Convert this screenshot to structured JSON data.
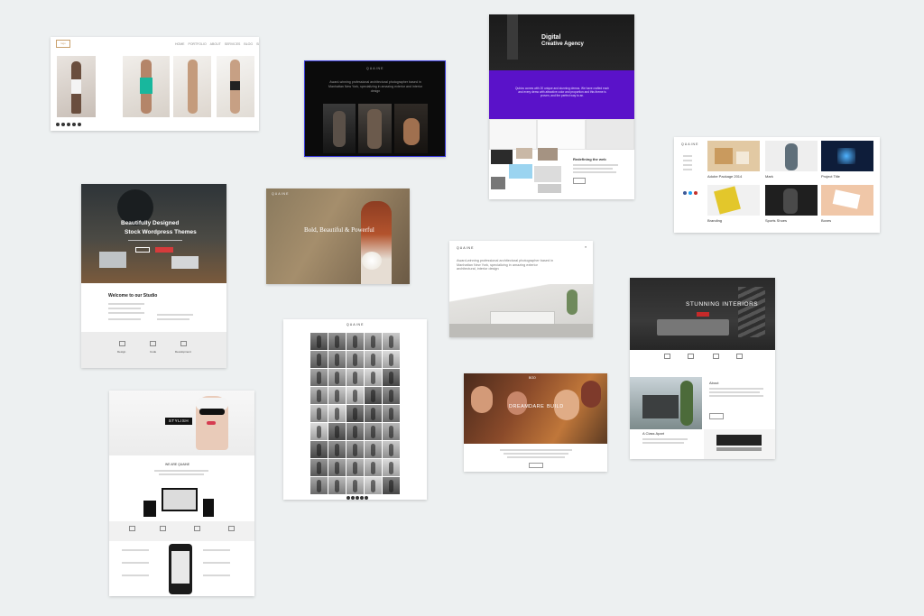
{
  "colors": {
    "background": "#edf0f1",
    "purple": "#5a12c9",
    "dark": "#111111",
    "red": "#c62a2a"
  },
  "card1": {
    "logo": "logo",
    "nav": [
      "HOME",
      "PORTFOLIO",
      "ABOUT",
      "SERVICES",
      "BLOG",
      "SHOP",
      "CONTACT"
    ]
  },
  "card2": {
    "brand": "QUAINE",
    "text": "Award-winning professional architectural photographer based in Manhattan New York, specializing in amazing exterior and interior design"
  },
  "card3": {
    "title1": "Digital",
    "title2": "Creative Agency",
    "purple_text": "Qubics comes with 20 unique and stunning demos. We have crafted each and every demo with attractive color and proportion and this theme is proven, and the perfect way to an.",
    "sub": "Redefining the web"
  },
  "card4": {
    "brand": "QUAINE",
    "items": [
      "Adobe Package 2014",
      "Mark",
      "Project Title",
      "Branding",
      "Sports Shoes",
      "Boxes"
    ]
  },
  "card5": {
    "hero1": "Beautifully Designed",
    "hero2": "Stock Wordpress Themes",
    "welcome": "Welcome to our Studio",
    "features": [
      "Design",
      "Code",
      "Development"
    ]
  },
  "card6": {
    "brand": "QUAINE",
    "hero": "Bold, Beautiful & Powerful"
  },
  "card7": {
    "brand": "QUAINE",
    "text": "Award-winning professional architectural photographer based in Manhattan New York, specializing in amazing exterior architectural, interior design"
  },
  "card8": {
    "hero": "STUNNING INTERIORS",
    "about": "About",
    "about2": "A Class Apart"
  },
  "card9": {
    "badge": "STYLISH",
    "section": "WE ARE QUAINE"
  },
  "card10": {
    "brand": "QUAINE"
  },
  "card11": {
    "hero_words": [
      "DREAM",
      "DARE",
      "BUILD"
    ],
    "brand": "BOO"
  }
}
